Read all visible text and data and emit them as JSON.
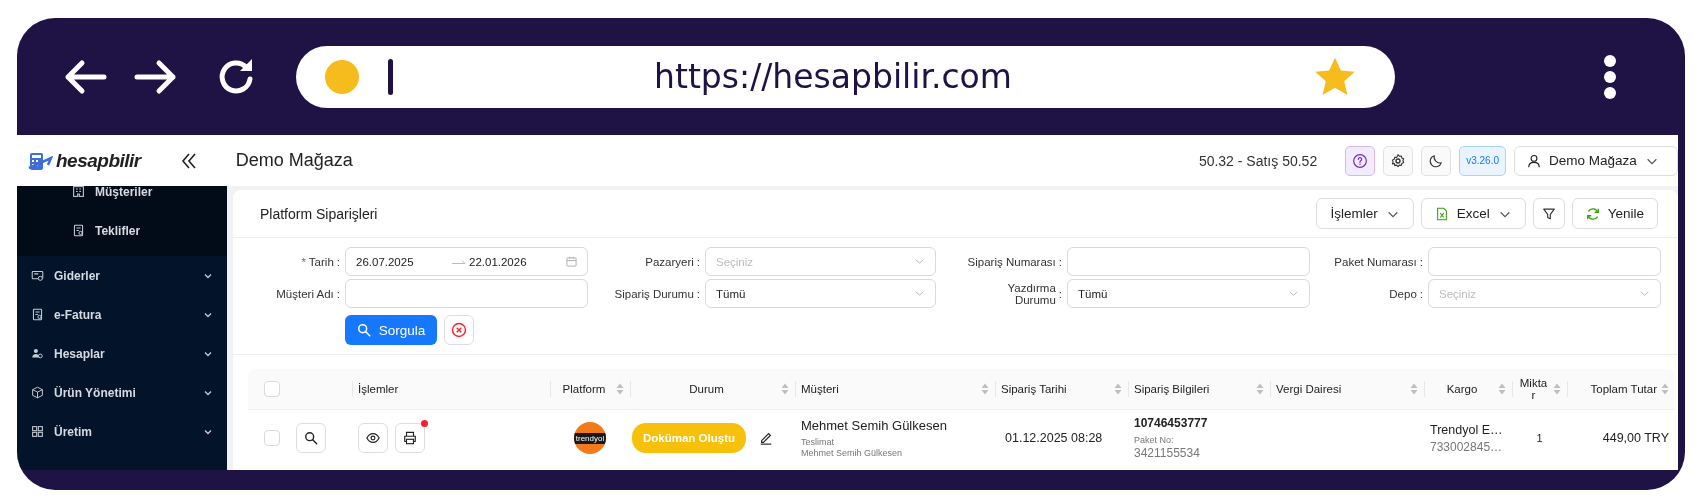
{
  "browser": {
    "url": "https://hesapbilir.com",
    "bookmarked": true
  },
  "app_header": {
    "logo": "hesapbilir",
    "store": "Demo Mağaza",
    "rate": "50.32 - Satış 50.52",
    "version": "v3.26.0",
    "user": "Demo Mağaza"
  },
  "sidebar": {
    "items": [
      {
        "label": "Müşteriler",
        "kind": "sub"
      },
      {
        "label": "Teklifler",
        "kind": "sub"
      },
      {
        "label": "Giderler",
        "kind": "group",
        "expanded": false
      },
      {
        "label": "e-Fatura",
        "kind": "group",
        "expanded": false
      },
      {
        "label": "Hesaplar",
        "kind": "group",
        "expanded": false
      },
      {
        "label": "Ürün Yönetimi",
        "kind": "group",
        "expanded": false
      },
      {
        "label": "Üretim",
        "kind": "group",
        "expanded": false
      }
    ]
  },
  "card": {
    "title": "Platform Siparişleri",
    "toolbar": [
      {
        "label": "İşlemler",
        "kind": "dropdown"
      },
      {
        "label": "Excel",
        "kind": "excel"
      },
      {
        "kind": "filter"
      },
      {
        "label": "Yenile",
        "kind": "refresh"
      }
    ],
    "filters": [
      {
        "label": "Tarih",
        "colon": ":",
        "required_mark": "*",
        "kind": "daterange",
        "start": "26.07.2025",
        "end": "22.01.2026"
      },
      {
        "label": "Pazaryeri",
        "colon": ":",
        "kind": "select",
        "placeholder": "Seçiniz"
      },
      {
        "label": "Sipariş Numarası",
        "colon": ":",
        "kind": "input"
      },
      {
        "label": "Paket Numarası",
        "colon": ":",
        "kind": "input"
      },
      {
        "label": "Müşteri Adı",
        "colon": ":",
        "kind": "input"
      },
      {
        "label": "Sipariş Durumu",
        "colon": ":",
        "kind": "select",
        "value": "Tümü"
      },
      {
        "label": "Yazdırma Durumu",
        "colon": ":",
        "kind": "select",
        "value": "Tümü"
      },
      {
        "label": "Depo",
        "colon": ":",
        "kind": "select",
        "placeholder": "Seçiniz"
      }
    ],
    "search_button": "Sorgula"
  },
  "table": {
    "header_checked": false,
    "columns": [
      {
        "label": "İşlemler",
        "sortable": false
      },
      {
        "label": "Platform",
        "sortable": true
      },
      {
        "label": "Durum",
        "sortable": true
      },
      {
        "label": "Müşteri",
        "sortable": true
      },
      {
        "label": "Sipariş Tarihi",
        "sortable": true
      },
      {
        "label": "Sipariş Bilgileri",
        "sortable": true
      },
      {
        "label": "Vergi Dairesi",
        "sortable": true
      },
      {
        "label": "Kargo",
        "sortable": true
      },
      {
        "label": "Miktar",
        "sortable": true
      },
      {
        "label": "Toplam Tutar",
        "sortable": true
      }
    ],
    "rows": [
      {
        "checked": false,
        "print_alert": true,
        "platform": "trendyol",
        "status": "Doküman Oluştu",
        "customer": "Mehmet Semih Gülkesen",
        "delivery_label": "Teslimat",
        "delivery_name": "Mehmet Semih Gülkesen",
        "order_date": "01.12.2025 08:28",
        "order_number": "10746453777",
        "package_label": "Paket No:",
        "package_number": "3421155534",
        "carrier": "Trendyol E…",
        "tracking": "733002845…",
        "quantity": "1",
        "total": "449,00 TRY"
      }
    ]
  }
}
